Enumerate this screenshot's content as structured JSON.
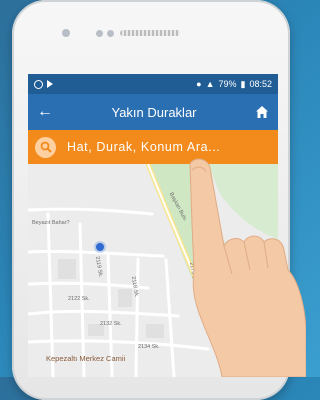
{
  "statusbar": {
    "battery": "79%",
    "time": "08:52"
  },
  "appbar": {
    "title": "Yakın Duraklar",
    "back_icon": "arrow-left-icon",
    "home_icon": "home-icon"
  },
  "search": {
    "placeholder": "Hat, Durak, Konum Ara..."
  },
  "map": {
    "labels": {
      "area": "Beyazıt Bahar?",
      "road": "Başkan Bulv.",
      "street_1": "2122 Sk.",
      "street_2": "2118 Sk.",
      "street_3": "2132 Sk.",
      "street_4": "2134 Sk.",
      "street_5": "2119 Sk.",
      "street_6": "2176 Sk."
    },
    "poi": "Kepezaltı Merkez Camii"
  },
  "colors": {
    "appbar": "#2a6fb2",
    "statusbar": "#1f5d94",
    "searchbar": "#f28a1c",
    "location_dot": "#2f6ad0",
    "road_green": "#cfe7c3"
  }
}
